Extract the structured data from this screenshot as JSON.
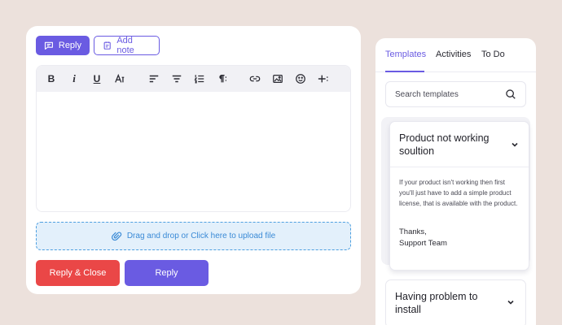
{
  "composer": {
    "mode_tabs": {
      "reply_label": "Reply",
      "note_label": "Add note"
    },
    "toolbar_icons": [
      "bold-icon",
      "italic-icon",
      "underline-icon",
      "text-size-icon",
      "align-left-icon",
      "align-center-icon",
      "ordered-list-icon",
      "paragraph-icon",
      "link-icon",
      "image-icon",
      "emoji-icon",
      "insert-icon"
    ],
    "toolbar_glyphs": {
      "bold": "B",
      "italic": "i",
      "underline": "U"
    },
    "dropzone_text": "Drag and drop or Click here to upload file",
    "reply_close_label": "Reply & Close",
    "reply_label": "Reply"
  },
  "templates_panel": {
    "tabs": [
      {
        "label": "Templates",
        "active": true
      },
      {
        "label": "Activities",
        "active": false
      },
      {
        "label": "To Do",
        "active": false
      }
    ],
    "search": {
      "placeholder": "Search templates"
    },
    "templates": [
      {
        "title": "Product not working soultion",
        "expanded": true,
        "body": "If your product isn't working then first you'll just have to add a simple product license, that is available with the product.",
        "sign_1": "Thanks,",
        "sign_2": "Support Team"
      },
      {
        "title": "Having problem to install",
        "expanded": false
      }
    ]
  },
  "colors": {
    "background": "#ece1dc",
    "accent": "#6a5be2",
    "danger": "#ea4747",
    "dropzone_bg": "#e3f0fb",
    "dropzone_text": "#3a8ad6"
  }
}
